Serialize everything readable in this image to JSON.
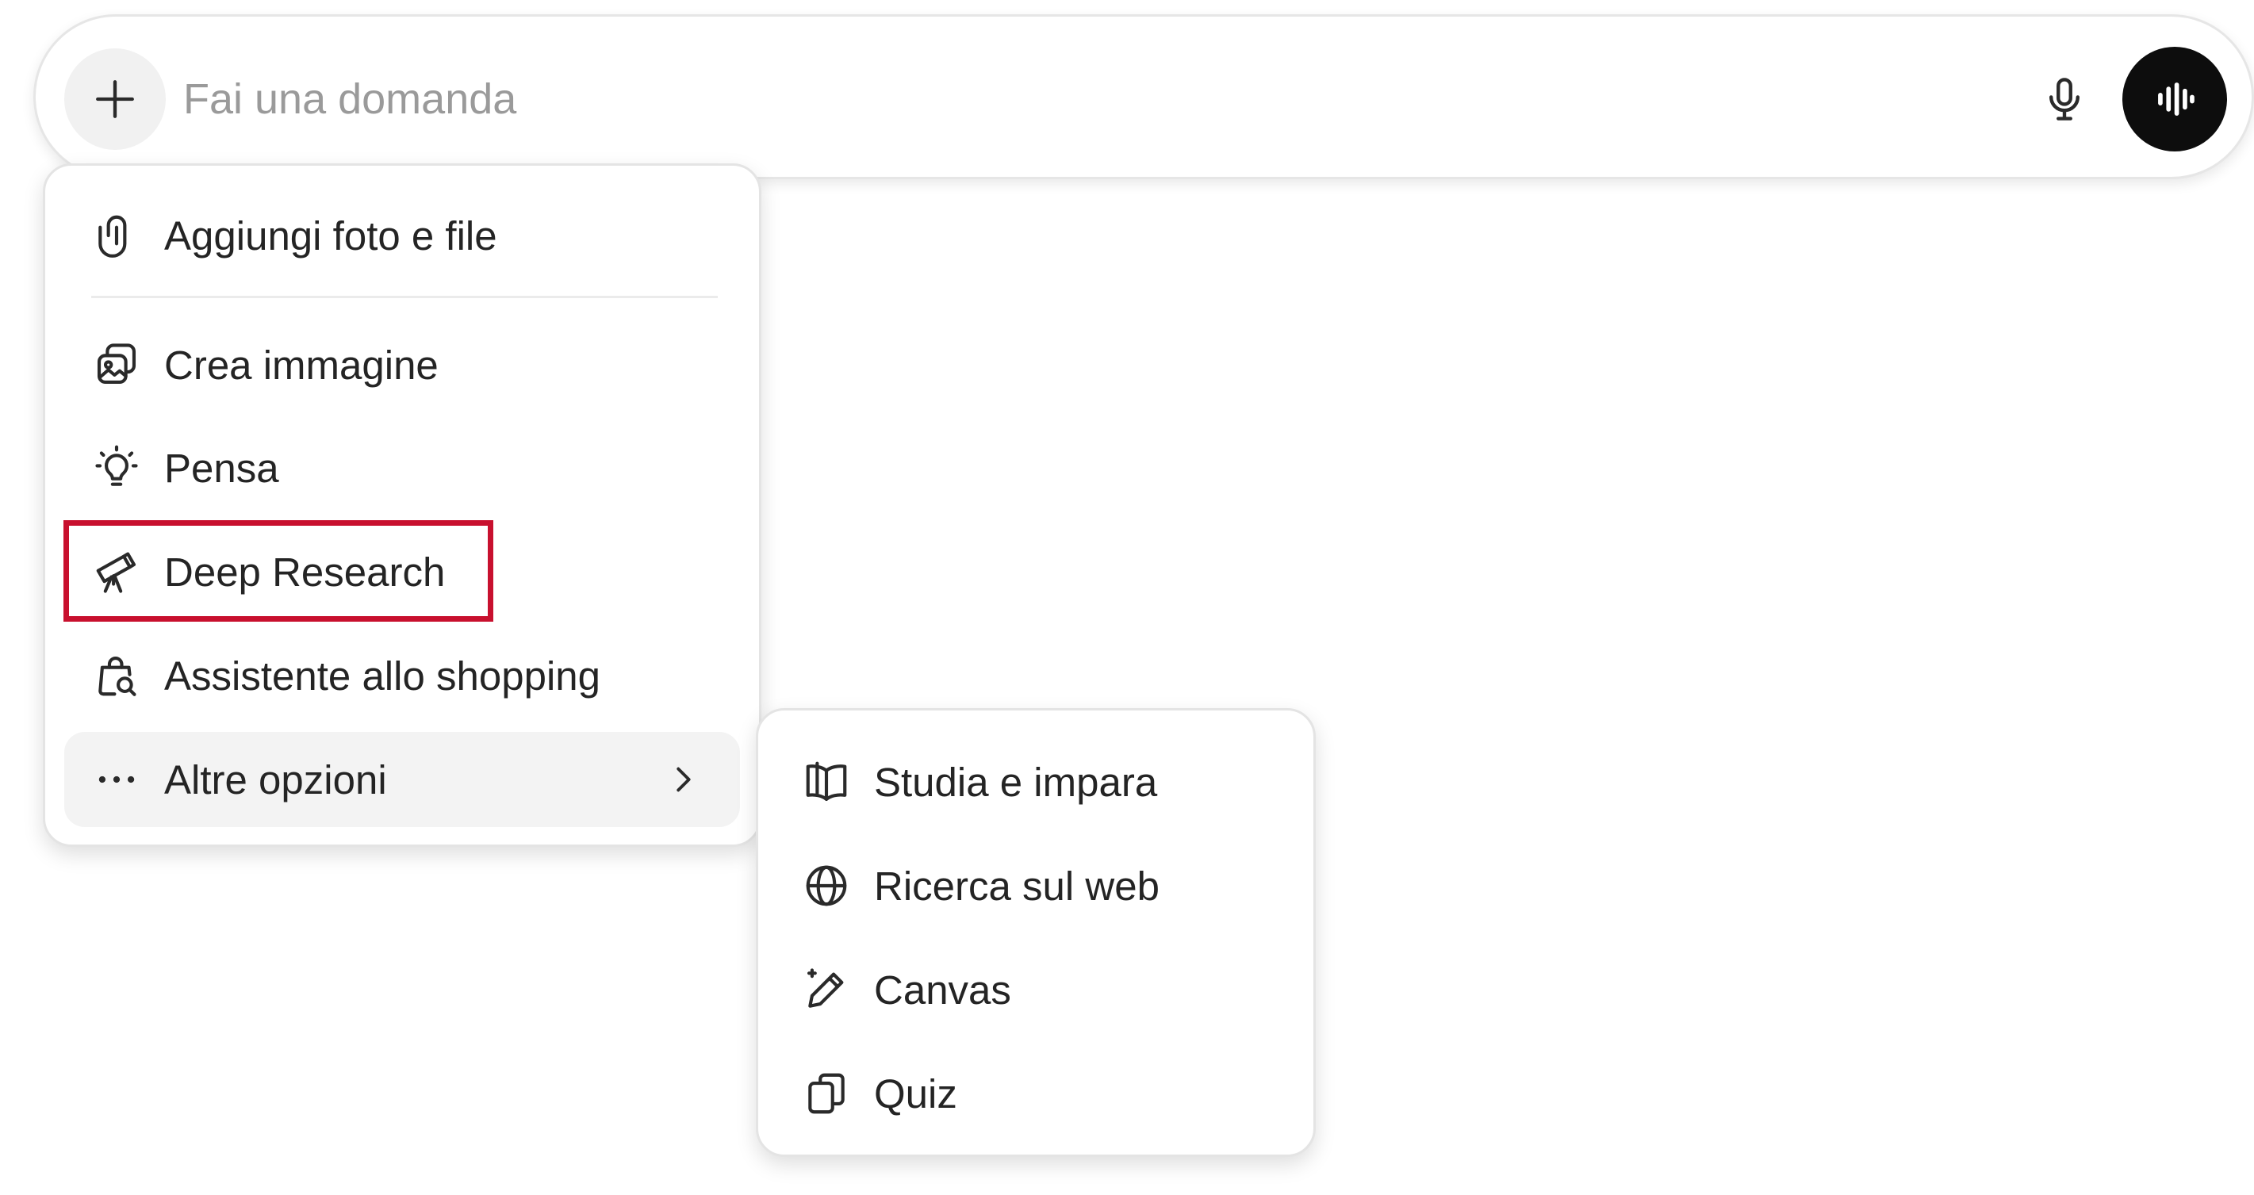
{
  "composer": {
    "placeholder": "Fai una domanda",
    "icons": {
      "add": "plus-icon",
      "mic": "microphone-icon",
      "voice": "voice-waveform-icon"
    }
  },
  "menu": {
    "attach": {
      "label": "Aggiungi foto e file",
      "icon": "paperclip-icon"
    },
    "items": [
      {
        "label": "Crea immagine",
        "icon": "image-icon"
      },
      {
        "label": "Pensa",
        "icon": "lightbulb-icon"
      },
      {
        "label": "Deep Research",
        "icon": "telescope-icon"
      },
      {
        "label": "Assistente allo shopping",
        "icon": "shopping-bag-search-icon"
      }
    ],
    "more": {
      "label": "Altre opzioni",
      "icon": "more-dots-icon",
      "chevron": "chevron-right-icon"
    }
  },
  "submenu": {
    "items": [
      {
        "label": "Studia e impara",
        "icon": "open-book-icon"
      },
      {
        "label": "Ricerca sul web",
        "icon": "globe-icon"
      },
      {
        "label": "Canvas",
        "icon": "pencil-sparkle-icon"
      },
      {
        "label": "Quiz",
        "icon": "cards-icon"
      }
    ]
  },
  "colors": {
    "highlight": "#c8102e",
    "voice_button": "#0d0d0d",
    "hover": "#f3f3f3"
  }
}
